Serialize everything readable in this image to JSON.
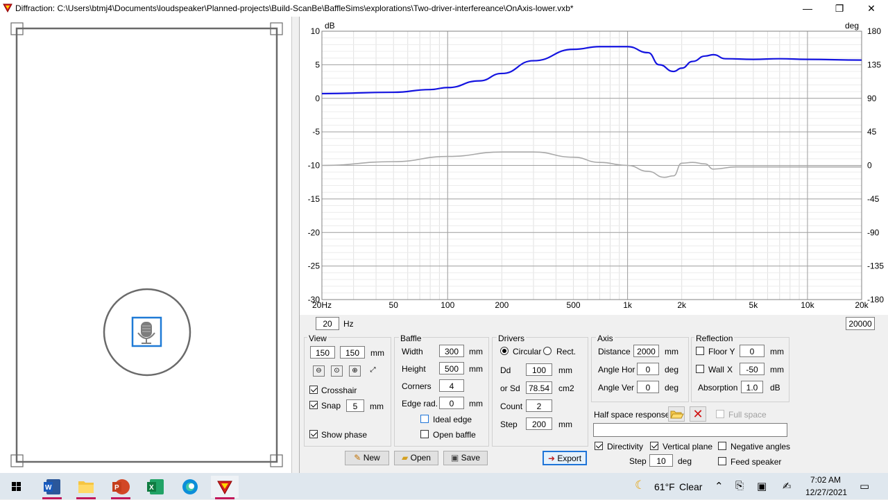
{
  "window": {
    "title": "Diffraction: C:\\Users\\btmj4\\Documents\\loudspeaker\\Planned-projects\\Build-ScanBe\\BaffleSims\\explorations\\Two-driver-interfereance\\OnAxis-lower.vxb*",
    "minimize": "—",
    "restore": "❐",
    "close": "✕"
  },
  "graph": {
    "left_unit": "dB",
    "right_unit": "deg",
    "y_left_ticks": [
      "10",
      "5",
      "0",
      "-5",
      "-10",
      "-15",
      "-20",
      "-25",
      "-30"
    ],
    "y_right_ticks": [
      "180",
      "135",
      "90",
      "45",
      "0",
      "-45",
      "-90",
      "-135",
      "-180"
    ],
    "x_ticks": [
      "20Hz",
      "50",
      "100",
      "200",
      "500",
      "1k",
      "2k",
      "5k",
      "10k",
      "20k"
    ],
    "min_freq": "20",
    "min_freq_unit": "Hz",
    "max_freq": "20000",
    "colors": {
      "magnitude": "#1414e0",
      "phase": "#a8a8a8"
    }
  },
  "chart_data": {
    "type": "line",
    "xlabel": "",
    "ylabel": "dB",
    "y2label": "deg",
    "xscale": "log",
    "xlim": [
      20,
      20000
    ],
    "ylim": [
      -30,
      10
    ],
    "y2lim": [
      -180,
      180
    ],
    "grid": true,
    "series": [
      {
        "axis": "left",
        "x": [
          20,
          50,
          80,
          100,
          150,
          200,
          300,
          500,
          700,
          1000,
          1300,
          1500,
          1800,
          2000,
          2300,
          2700,
          3000,
          3500,
          5000,
          7000,
          10000,
          20000
        ],
        "values": [
          0.7,
          0.9,
          1.3,
          1.6,
          2.6,
          3.7,
          5.6,
          7.3,
          7.7,
          7.7,
          6.8,
          5.0,
          4.0,
          4.5,
          5.5,
          6.3,
          6.5,
          5.9,
          5.8,
          5.9,
          5.8,
          5.7
        ]
      },
      {
        "axis": "right",
        "x": [
          20,
          50,
          100,
          200,
          300,
          500,
          700,
          1000,
          1300,
          1600,
          1800,
          2000,
          2300,
          2700,
          3000,
          4000,
          5000,
          10000,
          20000
        ],
        "values": [
          0,
          5,
          12,
          18,
          18,
          11,
          4,
          0,
          -8,
          -16,
          -14,
          3,
          4,
          2,
          -5,
          -2,
          -2,
          -2,
          -2
        ]
      }
    ]
  },
  "view": {
    "title": "View",
    "x": "150",
    "y": "150",
    "unit": "mm",
    "crosshair": "Crosshair",
    "snap": "Snap",
    "snap_value": "5",
    "snap_unit": "mm",
    "show_phase": "Show phase"
  },
  "baffle": {
    "title": "Baffle",
    "width_label": "Width",
    "width": "300",
    "height_label": "Height",
    "height": "500",
    "corners_label": "Corners",
    "corners": "4",
    "edge_label": "Edge rad.",
    "edge": "0",
    "unit": "mm",
    "ideal_edge": "Ideal edge",
    "open_baffle": "Open baffle"
  },
  "drivers": {
    "title": "Drivers",
    "circular": "Circular",
    "rect": "Rect.",
    "dd_label": "Dd",
    "dd": "100",
    "dd_unit": "mm",
    "sd_label": "or Sd",
    "sd": "78.54",
    "sd_unit": "cm2",
    "count_label": "Count",
    "count": "2",
    "step_label": "Step",
    "step": "200",
    "step_unit": "mm"
  },
  "axis": {
    "title": "Axis",
    "distance_label": "Distance",
    "distance": "2000",
    "distance_unit": "mm",
    "hor_label": "Angle Hor",
    "hor": "0",
    "ver_label": "Angle Ver",
    "ver": "0",
    "deg": "deg"
  },
  "reflection": {
    "title": "Reflection",
    "floor_label": "Floor Y",
    "floor": "0",
    "wall_label": "Wall",
    "wall_axis": "X",
    "wall": "-50",
    "unit": "mm",
    "absorption_label": "Absorption",
    "absorption": "1.0",
    "absorption_unit": "dB"
  },
  "half_space": {
    "label": "Half space response",
    "full_space": "Full space",
    "directivity": "Directivity",
    "vertical_plane": "Vertical plane",
    "negative_angles": "Negative angles",
    "step_label": "Step",
    "step": "10",
    "step_unit": "deg",
    "feed_speaker": "Feed speaker"
  },
  "buttons": {
    "new": "New",
    "open": "Open",
    "save": "Save",
    "export": "Export"
  },
  "taskbar": {
    "weather_temp": "61°F",
    "weather_desc": "Clear",
    "time": "7:02 AM",
    "date": "12/27/2021"
  }
}
